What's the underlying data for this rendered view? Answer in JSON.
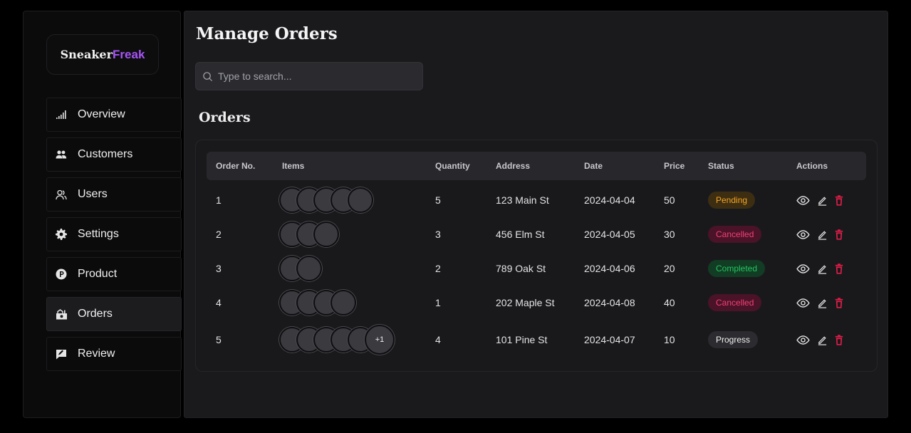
{
  "brand": {
    "part1": "Sneaker",
    "part2": "Freak"
  },
  "nav": [
    {
      "label": "Overview",
      "icon": "chart-bars-icon",
      "active": false
    },
    {
      "label": "Customers",
      "icon": "customers-icon",
      "active": false
    },
    {
      "label": "Users",
      "icon": "users-icon",
      "active": false
    },
    {
      "label": "Settings",
      "icon": "gear-icon",
      "active": false
    },
    {
      "label": "Product",
      "icon": "product-icon",
      "active": false
    },
    {
      "label": "Orders",
      "icon": "orders-icon",
      "active": true
    },
    {
      "label": "Review",
      "icon": "review-icon",
      "active": false
    }
  ],
  "page_title": "Manage Orders",
  "search": {
    "placeholder": "Type to search...",
    "value": ""
  },
  "section_title": "Orders",
  "table": {
    "columns": [
      "Order No.",
      "Items",
      "Quantity",
      "Address",
      "Date",
      "Price",
      "Status",
      "Actions"
    ],
    "rows": [
      {
        "order_no": "1",
        "items_shown": 5,
        "items_more": "",
        "quantity": "5",
        "address": "123 Main St",
        "date": "2024-04-04",
        "price": "50",
        "status": "Pending"
      },
      {
        "order_no": "2",
        "items_shown": 3,
        "items_more": "",
        "quantity": "3",
        "address": "456 Elm St",
        "date": "2024-04-05",
        "price": "30",
        "status": "Cancelled"
      },
      {
        "order_no": "3",
        "items_shown": 2,
        "items_more": "",
        "quantity": "2",
        "address": "789 Oak St",
        "date": "2024-04-06",
        "price": "20",
        "status": "Completed"
      },
      {
        "order_no": "4",
        "items_shown": 4,
        "items_more": "",
        "quantity": "1",
        "address": "202 Maple St",
        "date": "2024-04-08",
        "price": "40",
        "status": "Cancelled"
      },
      {
        "order_no": "5",
        "items_shown": 5,
        "items_more": "+1",
        "quantity": "4",
        "address": "101 Pine St",
        "date": "2024-04-07",
        "price": "10",
        "status": "Progress"
      }
    ]
  },
  "status_colors": {
    "Pending": {
      "bg": "#3d2e12",
      "fg": "#f5a524"
    },
    "Cancelled": {
      "bg": "#4a1327",
      "fg": "#f43f76"
    },
    "Completed": {
      "bg": "#123c24",
      "fg": "#22c55e"
    },
    "Progress": {
      "bg": "#2c2c30",
      "fg": "#f0f0f0"
    }
  },
  "colors": {
    "brand_accent": "#a855f7",
    "delete": "#e11d48"
  }
}
